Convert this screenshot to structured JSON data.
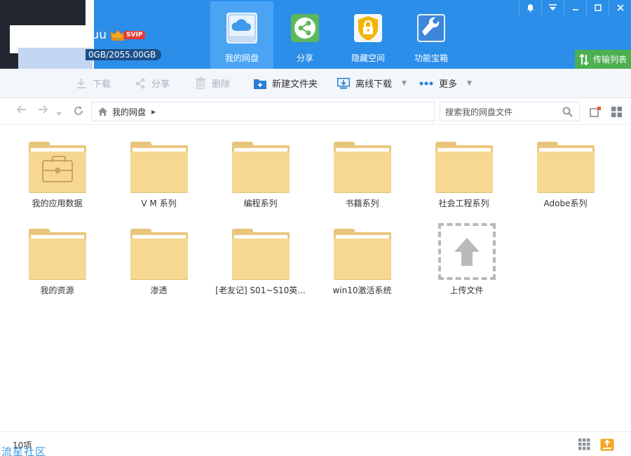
{
  "header": {
    "username": "Yuu",
    "vip_badge": "SVIP",
    "storage": "0GB/2055.00GB",
    "tabs": [
      {
        "label": "我的网盘",
        "icon": "cloud-icon",
        "active": true
      },
      {
        "label": "分享",
        "icon": "share-icon",
        "active": false
      },
      {
        "label": "隐藏空间",
        "icon": "lock-icon",
        "active": false
      },
      {
        "label": "功能宝箱",
        "icon": "wrench-icon",
        "active": false
      }
    ],
    "window_controls": [
      "bell-icon",
      "menu-icon",
      "minimize-icon",
      "maximize-icon",
      "close-icon"
    ],
    "transfer_label": "传输列表"
  },
  "toolbar": {
    "download": "下载",
    "share": "分享",
    "delete": "删除",
    "new_folder": "新建文件夹",
    "offline_download": "离线下载",
    "more": "更多"
  },
  "address": {
    "breadcrumb": "我的网盘",
    "search_placeholder": "搜索我的网盘文件"
  },
  "files": [
    {
      "name": "我的应用数据",
      "type": "app-folder"
    },
    {
      "name": "V M 系列",
      "type": "folder"
    },
    {
      "name": "编程系列",
      "type": "folder"
    },
    {
      "name": "书籍系列",
      "type": "folder"
    },
    {
      "name": "社会工程系列",
      "type": "folder"
    },
    {
      "name": "Adobe系列",
      "type": "folder"
    },
    {
      "name": "我的资源",
      "type": "folder"
    },
    {
      "name": "渗透",
      "type": "folder"
    },
    {
      "name": "[老友记] S01~S10英...",
      "type": "folder"
    },
    {
      "name": "win10激活系统",
      "type": "folder"
    },
    {
      "name": "上传文件",
      "type": "upload"
    }
  ],
  "status": {
    "count": "10项",
    "watermark": "流星社区"
  },
  "colors": {
    "header_blue": "#2b8ee8",
    "active_tab": "#4aa4f3",
    "transfer_green": "#4caf50",
    "folder": "#f6d893"
  }
}
